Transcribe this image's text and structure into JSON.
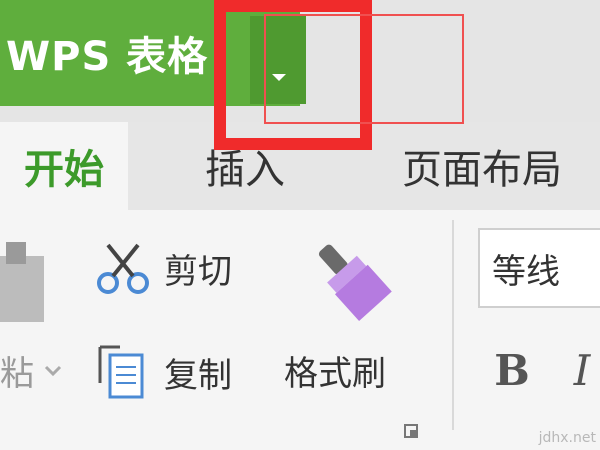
{
  "app": {
    "name": "WPS 表格"
  },
  "tabs": [
    {
      "label": "开始"
    },
    {
      "label": "插入"
    },
    {
      "label": "页面布局"
    }
  ],
  "clipboard": {
    "paste_label": "粘",
    "cut_label": "剪切",
    "copy_label": "复制",
    "format_painter_label": "格式刷"
  },
  "font": {
    "name": "等线",
    "bold_label": "B",
    "italic_label": "I"
  },
  "colors": {
    "app_green": "#5fae3d",
    "active_tab_text": "#3c9a2a",
    "highlight_red": "#f02b2b",
    "brush_purple": "#b57be0"
  },
  "watermark": "jdhx.net"
}
